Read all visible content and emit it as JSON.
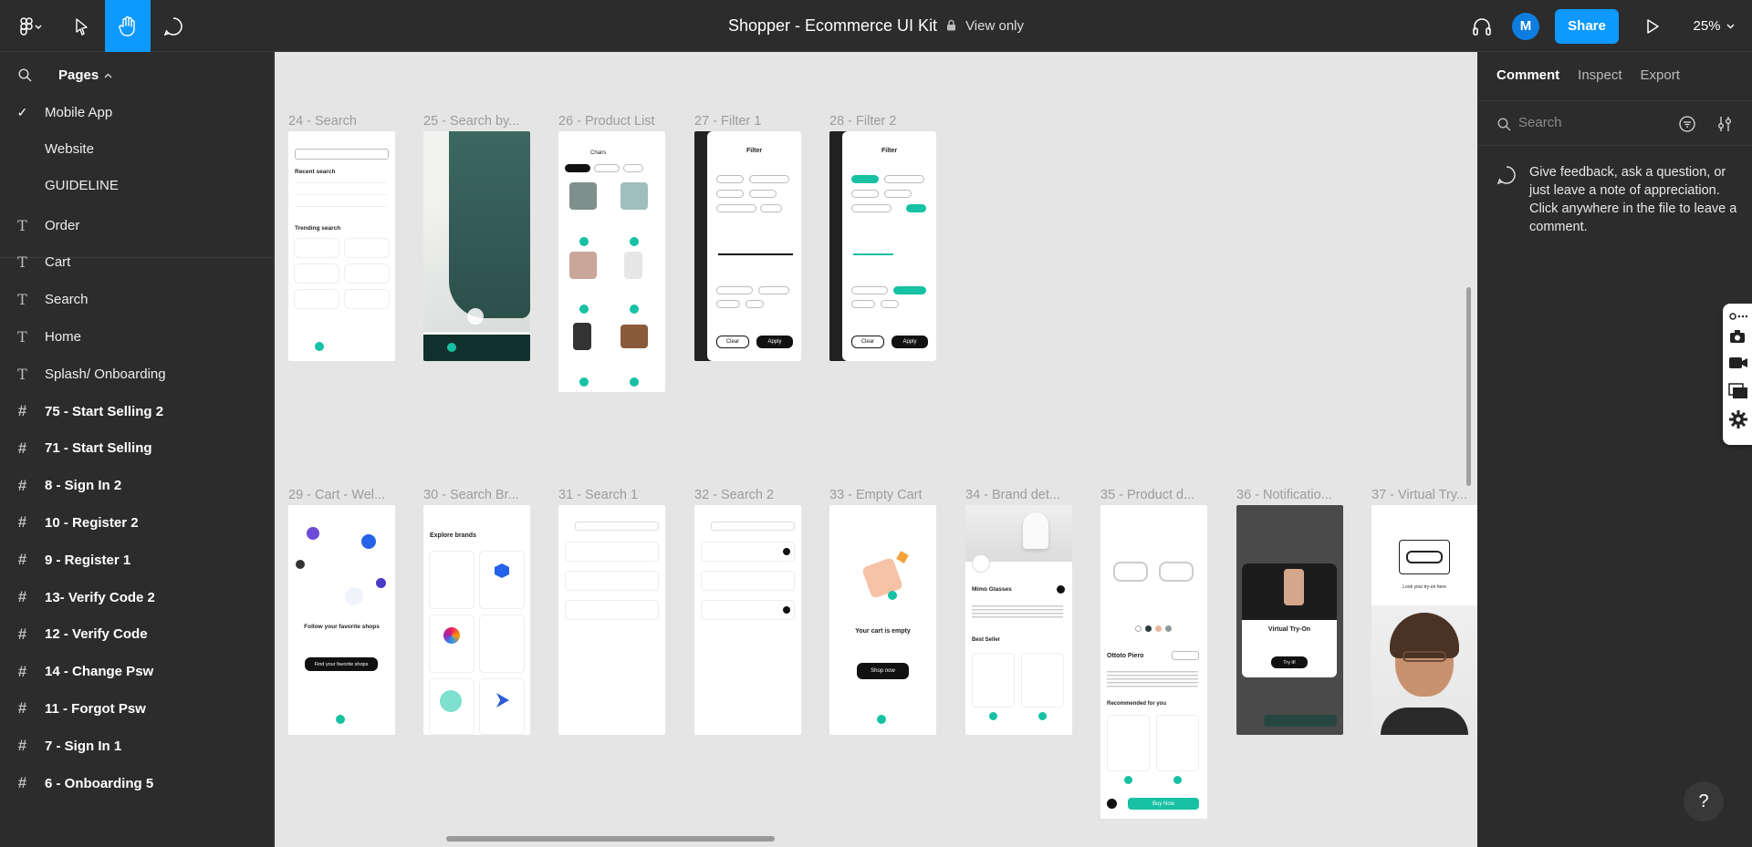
{
  "toolbar": {
    "file_title": "Shopper - Ecommerce UI Kit",
    "view_mode": "View only",
    "avatar_initial": "M",
    "share_label": "Share",
    "zoom": "25%"
  },
  "pages_panel": {
    "header": "Pages",
    "pages": [
      {
        "label": "Mobile App",
        "selected": true
      },
      {
        "label": "Website",
        "selected": false
      },
      {
        "label": "GUIDELINE",
        "selected": false
      }
    ]
  },
  "layers": [
    {
      "type": "text",
      "label": "Order"
    },
    {
      "type": "text",
      "label": "Cart"
    },
    {
      "type": "text",
      "label": "Search"
    },
    {
      "type": "text",
      "label": "Home"
    },
    {
      "type": "text",
      "label": "Splash/ Onboarding"
    },
    {
      "type": "frame",
      "label": "75 - Start Selling 2"
    },
    {
      "type": "frame",
      "label": "71 - Start Selling"
    },
    {
      "type": "frame",
      "label": "8 - Sign In 2"
    },
    {
      "type": "frame",
      "label": "10 - Register 2"
    },
    {
      "type": "frame",
      "label": "9 - Register 1"
    },
    {
      "type": "frame",
      "label": "13- Verify Code 2"
    },
    {
      "type": "frame",
      "label": "12 - Verify Code"
    },
    {
      "type": "frame",
      "label": "14  - Change Psw"
    },
    {
      "type": "frame",
      "label": "11 - Forgot Psw"
    },
    {
      "type": "frame",
      "label": "7 - Sign In 1"
    },
    {
      "type": "frame",
      "label": "6 - Onboarding 5"
    }
  ],
  "frames_row1": [
    "24 - Search",
    "25 - Search by...",
    "26 - Product List",
    "27 - Filter 1",
    "28 - Filter 2"
  ],
  "frames_row2": [
    "29 - Cart - Wel...",
    "30 - Search Br...",
    "31 - Search 1",
    "32 - Search 2",
    "33 - Empty Cart",
    "34 - Brand det...",
    "35 - Product d...",
    "36 - Notificatio...",
    "37 - Virtual Try..."
  ],
  "frame_text": {
    "search_recent": "Recent search",
    "search_trending": "Trending search",
    "product_list_title": "Chairs",
    "filter_title": "Filter",
    "filter_clear": "Clear",
    "filter_apply": "Apply",
    "cart_follow": "Follow your favorite shops",
    "cart_find": "Find your favorite shops",
    "explore_brands": "Explore brands",
    "empty_cart": "Your cart is empty",
    "shop_now": "Shop now",
    "brand_name": "Mimo Glasses",
    "best_seller": "Best Seller",
    "product_name": "Ottoto Piero",
    "recommended": "Recommended for you",
    "buy_now": "Buy Now",
    "virtual_try_on": "Virtual Try-On",
    "try_it": "Try it!",
    "look_frame": "Look your try-on here"
  },
  "right_panel": {
    "tabs": [
      "Comment",
      "Inspect",
      "Export"
    ],
    "active_tab": "Comment",
    "search_placeholder": "Search",
    "feedback_text": "Give feedback, ask a question, or just leave a note of appreciation. Click anywhere in the file to leave a comment."
  },
  "help_label": "?",
  "colors": {
    "accent": "#0d99ff",
    "brand_teal": "#16c1a4",
    "canvas": "#e5e5e5",
    "chrome": "#2c2c2c"
  }
}
